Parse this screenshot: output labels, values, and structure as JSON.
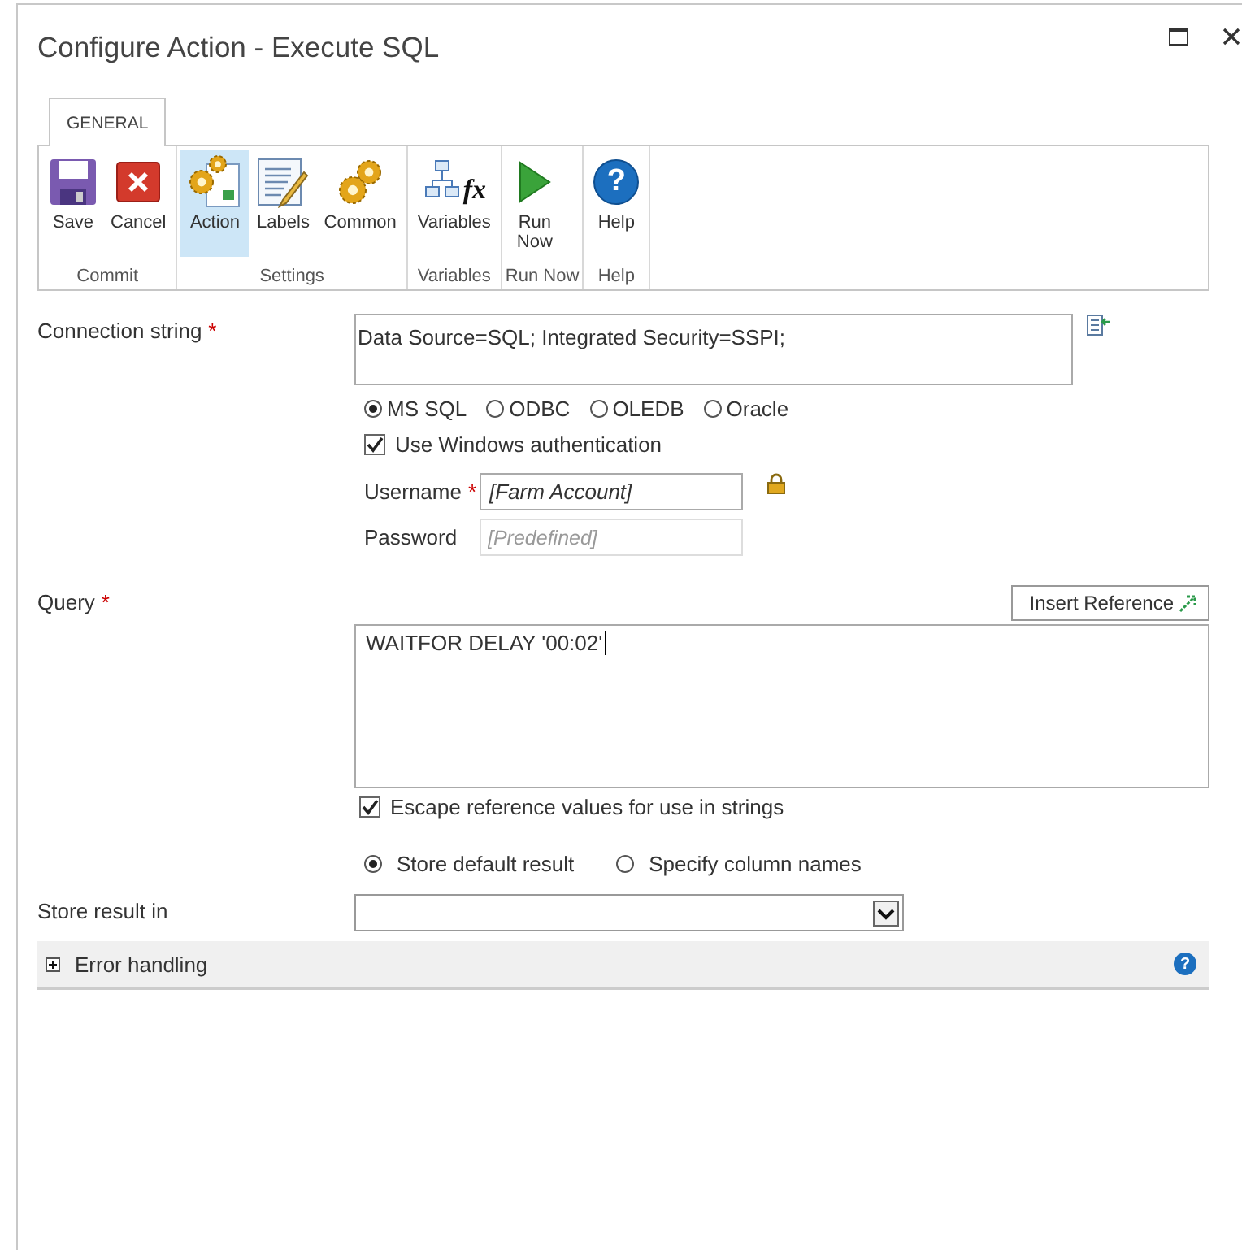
{
  "window": {
    "title": "Configure Action - Execute SQL"
  },
  "ribbon": {
    "tabs": [
      {
        "label": "GENERAL",
        "selected": true
      }
    ],
    "groups": [
      {
        "label": "Commit",
        "buttons": [
          {
            "label": "Save",
            "kind": "save",
            "selected": false
          },
          {
            "label": "Cancel",
            "kind": "cancel",
            "selected": false
          }
        ]
      },
      {
        "label": "Settings",
        "buttons": [
          {
            "label": "Action",
            "kind": "action",
            "selected": true
          },
          {
            "label": "Labels",
            "kind": "labels",
            "selected": false
          },
          {
            "label": "Common",
            "kind": "common",
            "selected": false
          }
        ]
      },
      {
        "label": "Variables",
        "buttons": [
          {
            "label": "Variables",
            "kind": "variables",
            "icon_text": "fx",
            "selected": false
          }
        ]
      },
      {
        "label": "Run Now",
        "buttons": [
          {
            "label": "Run Now",
            "kind": "run",
            "selected": false
          }
        ]
      },
      {
        "label": "Help",
        "buttons": [
          {
            "label": "Help",
            "kind": "help",
            "icon_text": "?",
            "selected": false
          }
        ]
      }
    ]
  },
  "connection": {
    "label": "Connection string",
    "required_mark": "*",
    "value": "Data Source=SQL; Integrated Security=SSPI;",
    "providers": [
      {
        "label": "MS SQL",
        "selected": true
      },
      {
        "label": "ODBC",
        "selected": false
      },
      {
        "label": "OLEDB",
        "selected": false
      },
      {
        "label": "Oracle",
        "selected": false
      }
    ],
    "windows_auth": {
      "label": "Use Windows authentication",
      "checked": true
    },
    "username": {
      "label": "Username",
      "required_mark": "*",
      "value": "[Farm Account]",
      "disabled": false
    },
    "password": {
      "label": "Password",
      "placeholder": "[Predefined]",
      "disabled": true
    }
  },
  "query": {
    "label": "Query",
    "required_mark": "*",
    "insert_button": "Insert Reference",
    "value": "WAITFOR DELAY '00:02'",
    "escape": {
      "label": "Escape reference values for use in strings",
      "checked": true
    },
    "result_modes": [
      {
        "label": "Store default result",
        "selected": true
      },
      {
        "label": "Specify column names",
        "selected": false
      }
    ]
  },
  "store_result": {
    "label": "Store result in"
  },
  "error_handling": {
    "label": "Error handling",
    "expanded": false,
    "help_icon_text": "?"
  }
}
